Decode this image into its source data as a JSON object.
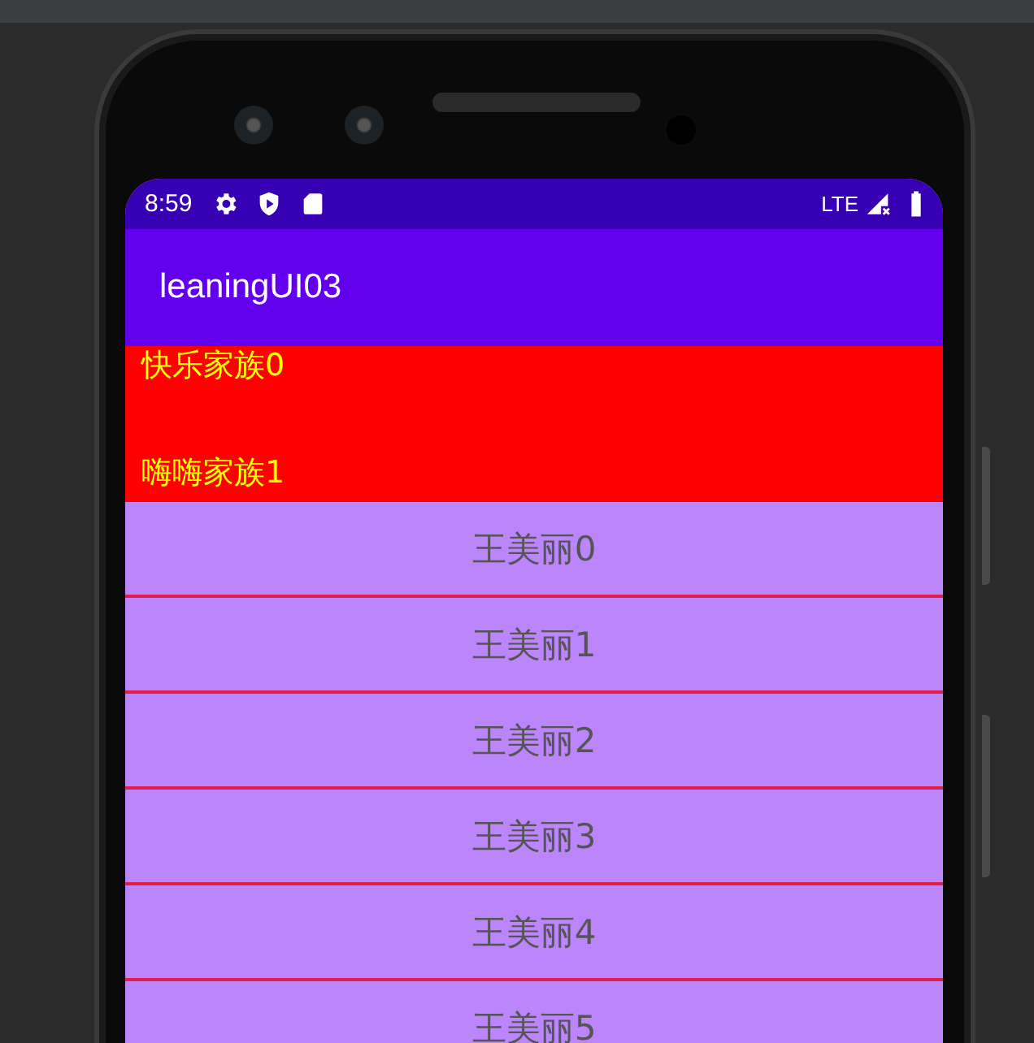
{
  "status_bar": {
    "time": "8:59",
    "network": "LTE"
  },
  "app_bar": {
    "title": "leaningUI03"
  },
  "header_items": [
    {
      "label": "快乐家族0"
    },
    {
      "label": "嗨嗨家族1"
    }
  ],
  "list_items": [
    {
      "label": "王美丽0"
    },
    {
      "label": "王美丽1"
    },
    {
      "label": "王美丽2"
    },
    {
      "label": "王美丽3"
    },
    {
      "label": "王美丽4"
    },
    {
      "label": "王美丽5"
    }
  ]
}
